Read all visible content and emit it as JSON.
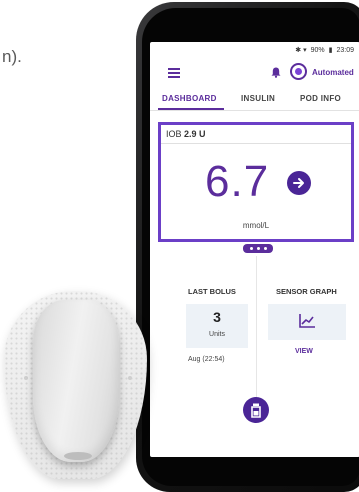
{
  "background_text": "n).",
  "status_bar": {
    "battery": "90%",
    "time": "23:09"
  },
  "app_bar": {
    "mode_label": "Automated"
  },
  "tabs": [
    {
      "label": "DASHBOARD",
      "active": true
    },
    {
      "label": "INSULIN",
      "active": false
    },
    {
      "label": "POD INFO",
      "active": false
    }
  ],
  "iob": {
    "label": "IOB",
    "value": "2.9 U"
  },
  "glucose": {
    "value": "6.7",
    "unit": "mmol/L"
  },
  "last_bolus": {
    "title": "LAST BOLUS",
    "value": "3",
    "unit": "Units",
    "time": "Aug (22:54)"
  },
  "sensor_graph": {
    "title": "SENSOR GRAPH",
    "link": "VIEW"
  },
  "colors": {
    "accent": "#5b2d9c",
    "card_border": "#6b3fc7",
    "button": "#4a2596"
  },
  "icons": [
    "menu-icon",
    "bell-icon",
    "arrow-right-icon",
    "graph-icon",
    "bolus-vial-icon"
  ]
}
